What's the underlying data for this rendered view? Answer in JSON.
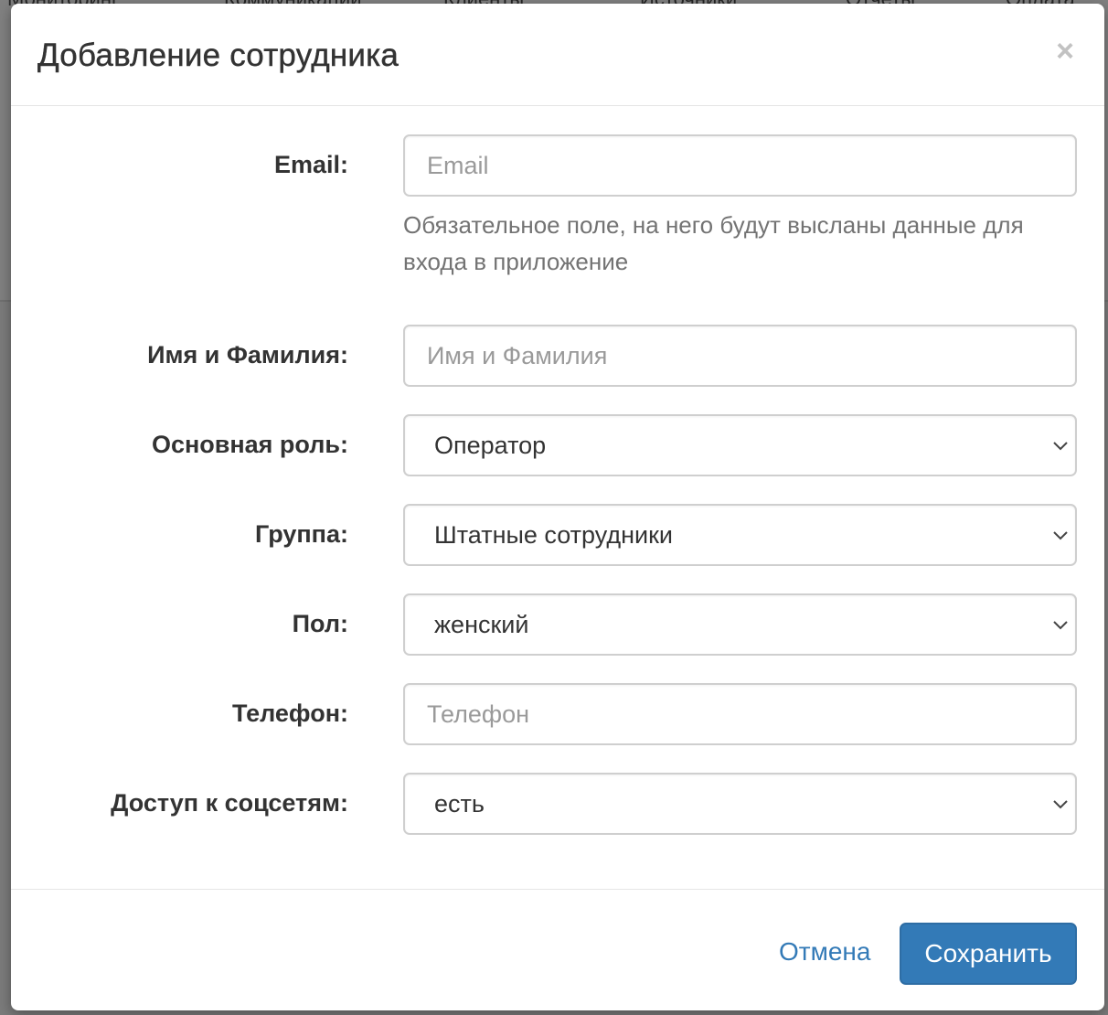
{
  "background": {
    "nav_fragments": [
      "Мониторинг",
      "Коммуникации",
      "Клиенты",
      "Источники",
      "Отчеты",
      "Оплата"
    ]
  },
  "modal": {
    "title": "Добавление сотрудника",
    "close_symbol": "×",
    "fields": {
      "email": {
        "label": "Email:",
        "placeholder": "Email",
        "value": "",
        "help": "Обязательное поле, на него будут высланы данные для входа в приложение"
      },
      "name": {
        "label": "Имя и Фамилия:",
        "placeholder": "Имя и Фамилия",
        "value": ""
      },
      "role": {
        "label": "Основная роль:",
        "selected": "Оператор"
      },
      "group": {
        "label": "Группа:",
        "selected": "Штатные сотрудники"
      },
      "gender": {
        "label": "Пол:",
        "selected": "женский"
      },
      "phone": {
        "label": "Телефон:",
        "placeholder": "Телефон",
        "value": ""
      },
      "social": {
        "label": "Доступ к соцсетям:",
        "selected": "есть"
      }
    },
    "footer": {
      "cancel_label": "Отмена",
      "save_label": "Сохранить"
    }
  },
  "colors": {
    "primary": "#337ab7",
    "link": "#337ab7",
    "border": "#cfcfcf",
    "backdrop": "#7b7b7b"
  },
  "icons": {
    "select_arrow": "chevron-down-icon",
    "close": "close-icon"
  }
}
